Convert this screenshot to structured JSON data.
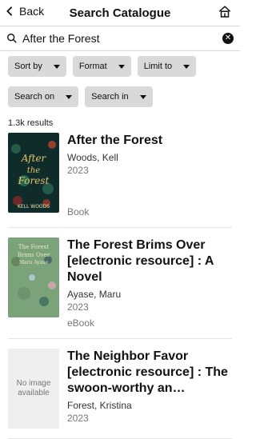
{
  "header": {
    "back_label": "Back",
    "title": "Search Catalogue",
    "home_icon": "home-icon"
  },
  "search": {
    "value": "After the Forest",
    "placeholder": "Search"
  },
  "filters": {
    "row1": [
      "Sort by",
      "Format",
      "Limit to"
    ],
    "row2": [
      "Search on",
      "Search in"
    ]
  },
  "results_count": "1.3k results",
  "results": [
    {
      "title": "After the Forest",
      "author": "Woods, Kell",
      "year": "2023",
      "format": "Book",
      "cover": {
        "title_text": "After the Forest",
        "author_text": "KELL WOODS",
        "bg": "#0f2b2a",
        "accent": "#e1c66b"
      }
    },
    {
      "title": "The Forest Brims Over [electronic resource] : A Novel",
      "author": "Ayase, Maru",
      "year": "2023",
      "format": "eBook",
      "cover": {
        "title_text": "The Forest Brims Over",
        "author_text": "Maru Ayase",
        "bg": "#7ba37a",
        "accent": "#f1e5c1"
      }
    },
    {
      "title": "The Neighbor Favor [electronic resource] : The swoon-worthy an…",
      "author": "Forest, Kristina",
      "year": "2023",
      "no_image_text": "No image available"
    }
  ],
  "colors": {
    "pill_bg": "#d9d9d9",
    "border": "#d7d7d7",
    "muted_text": "#777777"
  }
}
